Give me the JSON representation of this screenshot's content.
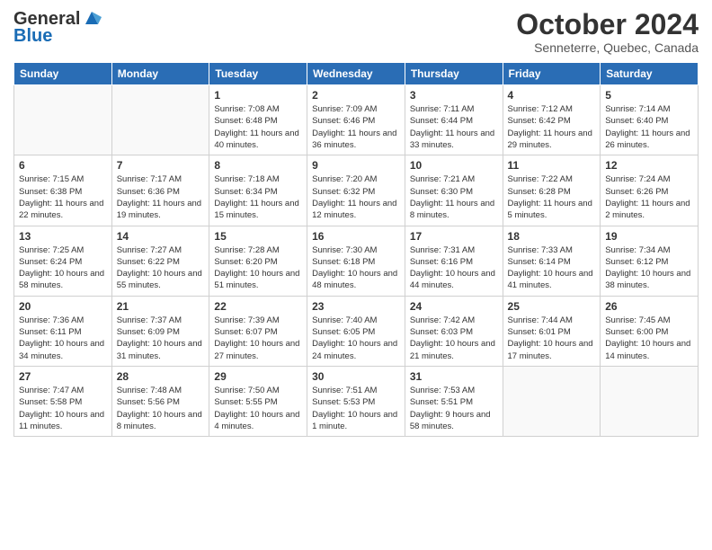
{
  "logo": {
    "general": "General",
    "blue": "Blue"
  },
  "title": "October 2024",
  "location": "Senneterre, Quebec, Canada",
  "days_of_week": [
    "Sunday",
    "Monday",
    "Tuesday",
    "Wednesday",
    "Thursday",
    "Friday",
    "Saturday"
  ],
  "weeks": [
    [
      {
        "day": "",
        "info": ""
      },
      {
        "day": "",
        "info": ""
      },
      {
        "day": "1",
        "info": "Sunrise: 7:08 AM\nSunset: 6:48 PM\nDaylight: 11 hours and 40 minutes."
      },
      {
        "day": "2",
        "info": "Sunrise: 7:09 AM\nSunset: 6:46 PM\nDaylight: 11 hours and 36 minutes."
      },
      {
        "day": "3",
        "info": "Sunrise: 7:11 AM\nSunset: 6:44 PM\nDaylight: 11 hours and 33 minutes."
      },
      {
        "day": "4",
        "info": "Sunrise: 7:12 AM\nSunset: 6:42 PM\nDaylight: 11 hours and 29 minutes."
      },
      {
        "day": "5",
        "info": "Sunrise: 7:14 AM\nSunset: 6:40 PM\nDaylight: 11 hours and 26 minutes."
      }
    ],
    [
      {
        "day": "6",
        "info": "Sunrise: 7:15 AM\nSunset: 6:38 PM\nDaylight: 11 hours and 22 minutes."
      },
      {
        "day": "7",
        "info": "Sunrise: 7:17 AM\nSunset: 6:36 PM\nDaylight: 11 hours and 19 minutes."
      },
      {
        "day": "8",
        "info": "Sunrise: 7:18 AM\nSunset: 6:34 PM\nDaylight: 11 hours and 15 minutes."
      },
      {
        "day": "9",
        "info": "Sunrise: 7:20 AM\nSunset: 6:32 PM\nDaylight: 11 hours and 12 minutes."
      },
      {
        "day": "10",
        "info": "Sunrise: 7:21 AM\nSunset: 6:30 PM\nDaylight: 11 hours and 8 minutes."
      },
      {
        "day": "11",
        "info": "Sunrise: 7:22 AM\nSunset: 6:28 PM\nDaylight: 11 hours and 5 minutes."
      },
      {
        "day": "12",
        "info": "Sunrise: 7:24 AM\nSunset: 6:26 PM\nDaylight: 11 hours and 2 minutes."
      }
    ],
    [
      {
        "day": "13",
        "info": "Sunrise: 7:25 AM\nSunset: 6:24 PM\nDaylight: 10 hours and 58 minutes."
      },
      {
        "day": "14",
        "info": "Sunrise: 7:27 AM\nSunset: 6:22 PM\nDaylight: 10 hours and 55 minutes."
      },
      {
        "day": "15",
        "info": "Sunrise: 7:28 AM\nSunset: 6:20 PM\nDaylight: 10 hours and 51 minutes."
      },
      {
        "day": "16",
        "info": "Sunrise: 7:30 AM\nSunset: 6:18 PM\nDaylight: 10 hours and 48 minutes."
      },
      {
        "day": "17",
        "info": "Sunrise: 7:31 AM\nSunset: 6:16 PM\nDaylight: 10 hours and 44 minutes."
      },
      {
        "day": "18",
        "info": "Sunrise: 7:33 AM\nSunset: 6:14 PM\nDaylight: 10 hours and 41 minutes."
      },
      {
        "day": "19",
        "info": "Sunrise: 7:34 AM\nSunset: 6:12 PM\nDaylight: 10 hours and 38 minutes."
      }
    ],
    [
      {
        "day": "20",
        "info": "Sunrise: 7:36 AM\nSunset: 6:11 PM\nDaylight: 10 hours and 34 minutes."
      },
      {
        "day": "21",
        "info": "Sunrise: 7:37 AM\nSunset: 6:09 PM\nDaylight: 10 hours and 31 minutes."
      },
      {
        "day": "22",
        "info": "Sunrise: 7:39 AM\nSunset: 6:07 PM\nDaylight: 10 hours and 27 minutes."
      },
      {
        "day": "23",
        "info": "Sunrise: 7:40 AM\nSunset: 6:05 PM\nDaylight: 10 hours and 24 minutes."
      },
      {
        "day": "24",
        "info": "Sunrise: 7:42 AM\nSunset: 6:03 PM\nDaylight: 10 hours and 21 minutes."
      },
      {
        "day": "25",
        "info": "Sunrise: 7:44 AM\nSunset: 6:01 PM\nDaylight: 10 hours and 17 minutes."
      },
      {
        "day": "26",
        "info": "Sunrise: 7:45 AM\nSunset: 6:00 PM\nDaylight: 10 hours and 14 minutes."
      }
    ],
    [
      {
        "day": "27",
        "info": "Sunrise: 7:47 AM\nSunset: 5:58 PM\nDaylight: 10 hours and 11 minutes."
      },
      {
        "day": "28",
        "info": "Sunrise: 7:48 AM\nSunset: 5:56 PM\nDaylight: 10 hours and 8 minutes."
      },
      {
        "day": "29",
        "info": "Sunrise: 7:50 AM\nSunset: 5:55 PM\nDaylight: 10 hours and 4 minutes."
      },
      {
        "day": "30",
        "info": "Sunrise: 7:51 AM\nSunset: 5:53 PM\nDaylight: 10 hours and 1 minute."
      },
      {
        "day": "31",
        "info": "Sunrise: 7:53 AM\nSunset: 5:51 PM\nDaylight: 9 hours and 58 minutes."
      },
      {
        "day": "",
        "info": ""
      },
      {
        "day": "",
        "info": ""
      }
    ]
  ]
}
